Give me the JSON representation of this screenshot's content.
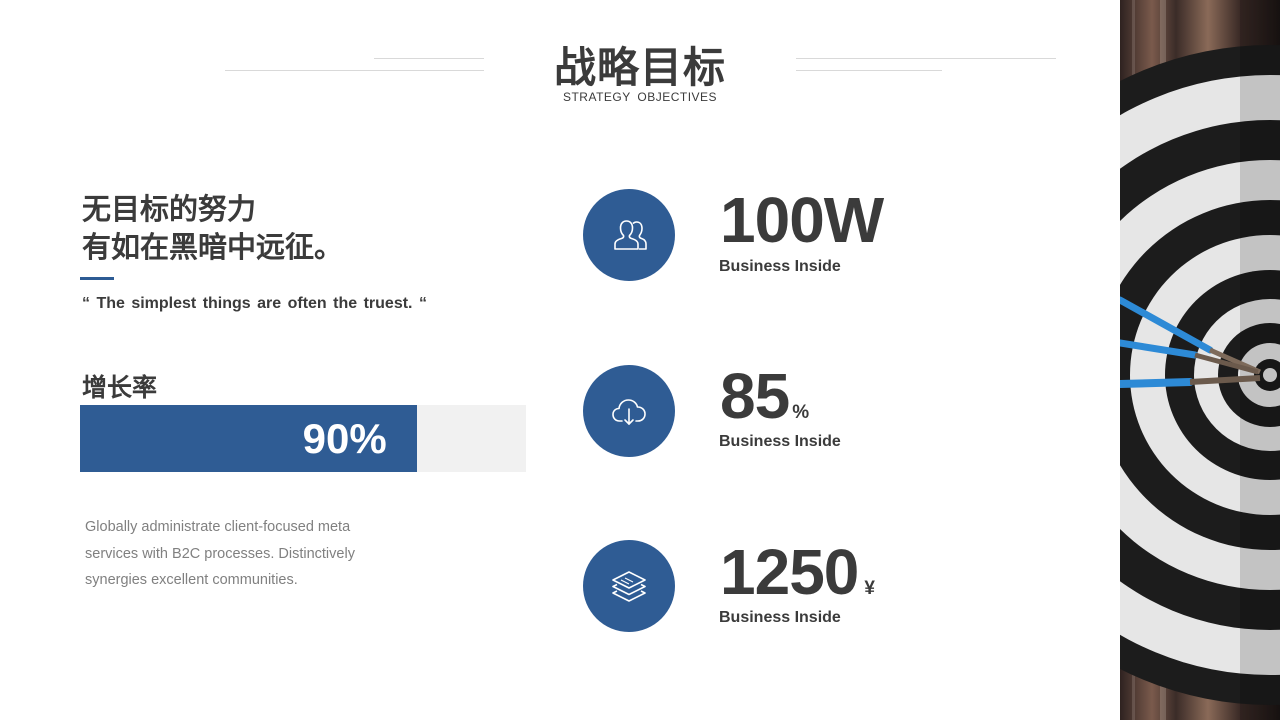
{
  "header": {
    "title": "战略目标",
    "subtitle": "STRATEGY  OBJECTIVES"
  },
  "left": {
    "headline_line1": "无目标的努力",
    "headline_line2": "有如在黑暗中远征。",
    "quote": "“ The simplest  things are often the truest. “",
    "growth_label": "增长率",
    "progress": {
      "value": 0.755,
      "label": "90%"
    },
    "description": "Globally administrate client-focused meta services with B2C processes. Distinctively synergies excellent communities."
  },
  "stats": [
    {
      "icon": "users-icon",
      "value": "100W",
      "unit": "",
      "label": "Business Inside"
    },
    {
      "icon": "cloud-download-icon",
      "value": "85",
      "unit": "%",
      "label": "Business Inside"
    },
    {
      "icon": "layers-icon",
      "value": "1250",
      "unit": "¥",
      "label": "Business Inside"
    }
  ],
  "colors": {
    "accent": "#2f5c94",
    "text": "#3b3b3b",
    "muted": "#808080",
    "track": "#f1f1f1"
  }
}
